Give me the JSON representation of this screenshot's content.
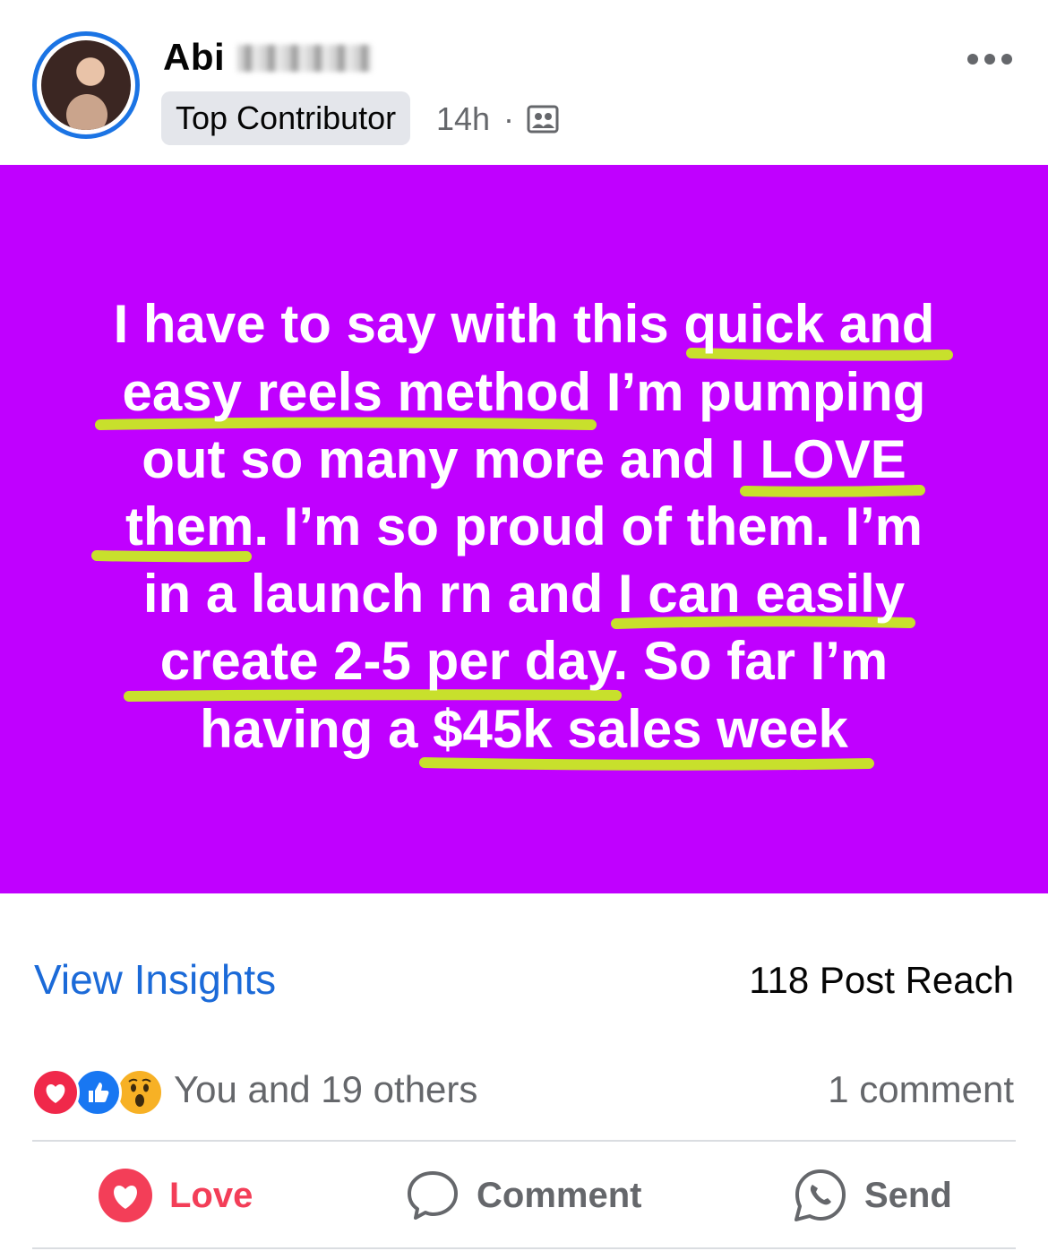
{
  "post": {
    "author_name": "Abi",
    "badge": "Top Contributor",
    "time": "14h",
    "separator": "·",
    "icons": {
      "audience": "group-photo-icon",
      "more": "more-horizontal-icon"
    },
    "image": {
      "background_color": "#c000ff",
      "underline_color": "#c8e02c",
      "text_lines": [
        "I have to say with this quick and",
        "easy reels method I’m pumping",
        "out so many more and I LOVE",
        "them. I’m so proud of them. I’m",
        "in a launch rn and I can easily",
        "create 2-5 per day. So far I’m",
        "having a $45k sales week"
      ]
    }
  },
  "insights": {
    "link_label": "View Insights",
    "reach_label": "118 Post Reach"
  },
  "reactions": {
    "icons": [
      "love-reaction-icon",
      "like-reaction-icon",
      "wow-reaction-icon"
    ],
    "summary": "You and 19 others",
    "comment_count": "1 comment"
  },
  "actions": {
    "love_label": "Love",
    "comment_label": "Comment",
    "send_label": "Send"
  }
}
